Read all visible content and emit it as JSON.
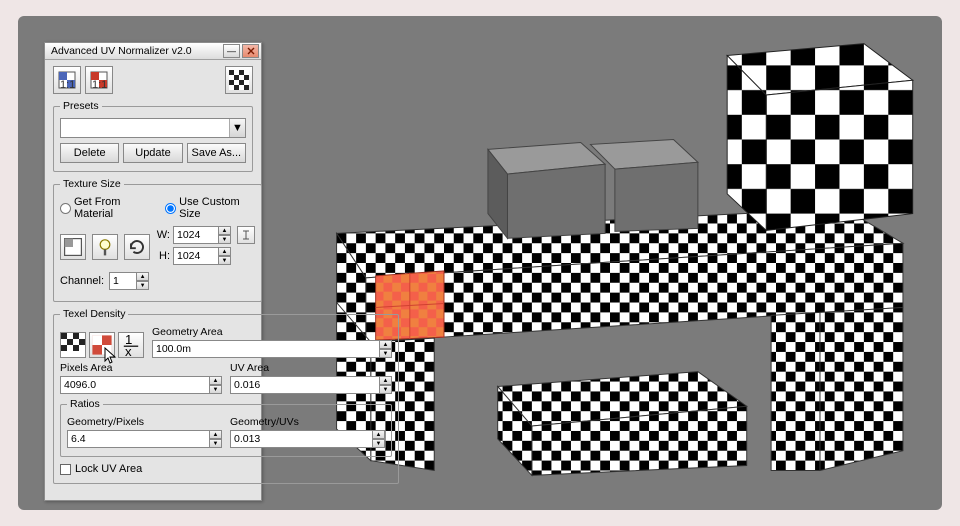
{
  "window": {
    "title": "Advanced UV Normalizer v2.0"
  },
  "presets": {
    "legend": "Presets",
    "delete": "Delete",
    "update": "Update",
    "saveas": "Save As..."
  },
  "texsize": {
    "legend": "Texture Size",
    "opt_material": "Get From Material",
    "opt_custom": "Use Custom Size",
    "w_label": "W:",
    "h_label": "H:",
    "w_value": "1024",
    "h_value": "1024",
    "channel_label": "Channel:",
    "channel_value": "1"
  },
  "texel": {
    "legend": "Texel Density",
    "geom_label": "Geometry Area",
    "geom_value": "100.0m",
    "pixels_label": "Pixels Area",
    "pixels_value": "4096.0",
    "uv_label": "UV Area",
    "uv_value": "0.016",
    "ratios_legend": "Ratios",
    "gp_label": "Geometry/Pixels",
    "gp_value": "6.4",
    "gu_label": "Geometry/UVs",
    "gu_value": "0.013",
    "lock_label": "Lock UV Area"
  }
}
